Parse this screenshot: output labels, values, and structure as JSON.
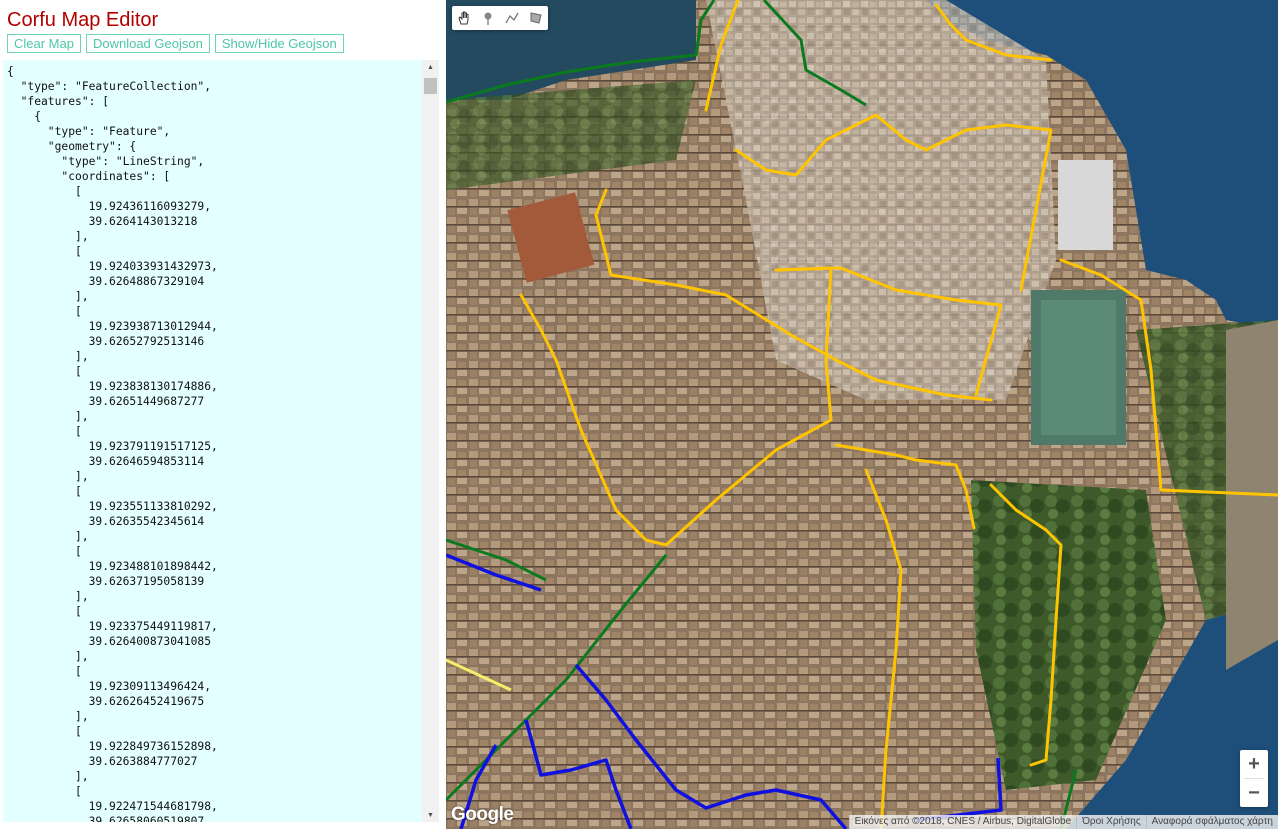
{
  "app": {
    "title": "Corfu Map Editor"
  },
  "buttons": {
    "clear": "Clear Map",
    "download": "Download Geojson",
    "toggle": "Show/Hide Geojson"
  },
  "geojson_text": "{\n  \"type\": \"FeatureCollection\",\n  \"features\": [\n    {\n      \"type\": \"Feature\",\n      \"geometry\": {\n        \"type\": \"LineString\",\n        \"coordinates\": [\n          [\n            19.92436116093279,\n            39.6264143013218\n          ],\n          [\n            19.924033931432973,\n            39.62648867329104\n          ],\n          [\n            19.923938713012944,\n            39.62652792513146\n          ],\n          [\n            19.923838130174886,\n            39.62651449687277\n          ],\n          [\n            19.923791191517125,\n            39.62646594853114\n          ],\n          [\n            19.923551133810292,\n            39.62635542345614\n          ],\n          [\n            19.923488101898442,\n            39.62637195058139\n          ],\n          [\n            19.923375449119817,\n            39.626400873041085\n          ],\n          [\n            19.92309113496424,\n            39.62626452419675\n          ],\n          [\n            19.922849736152898,\n            39.6263884777027\n          ],\n          [\n            19.922471544681798,\n            39.62658060519807",
  "map": {
    "tools": [
      "hand-icon",
      "marker-icon",
      "polyline-icon",
      "polygon-icon"
    ],
    "zoom_in": "+",
    "zoom_out": "−",
    "logo": "Google",
    "attribution": [
      "Εικόνες από ©2018, CNES / Airbus, DigitalGlobe",
      "Όροι Χρήσης",
      "Αναφορά σφάλματος χάρτη"
    ]
  },
  "colors": {
    "title": "#b20000",
    "button_text": "#4cc7a5",
    "json_background": "#e3ffff",
    "route_yellow": "#ffc400",
    "route_green": "#0b7a1e",
    "route_blue": "#1010e0",
    "sea": "#1e4f7a"
  }
}
